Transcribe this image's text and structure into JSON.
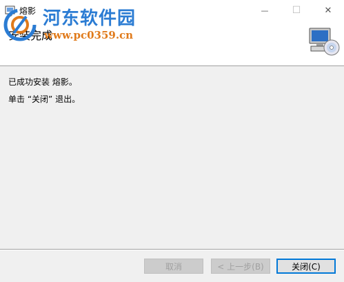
{
  "window": {
    "title": "熔影",
    "minimize_glyph": "—",
    "maximize_glyph": "☐",
    "close_glyph": "✕"
  },
  "header": {
    "title": "安装完成"
  },
  "watermark": {
    "name": "河东软件园",
    "url": "www.pc0359.cn"
  },
  "content": {
    "message1": "已成功安装 熔影。",
    "message2": "单击 “关闭” 退出。"
  },
  "buttons": {
    "cancel": "取消",
    "back": "< 上一步(B)",
    "close": "关闭(C)"
  }
}
